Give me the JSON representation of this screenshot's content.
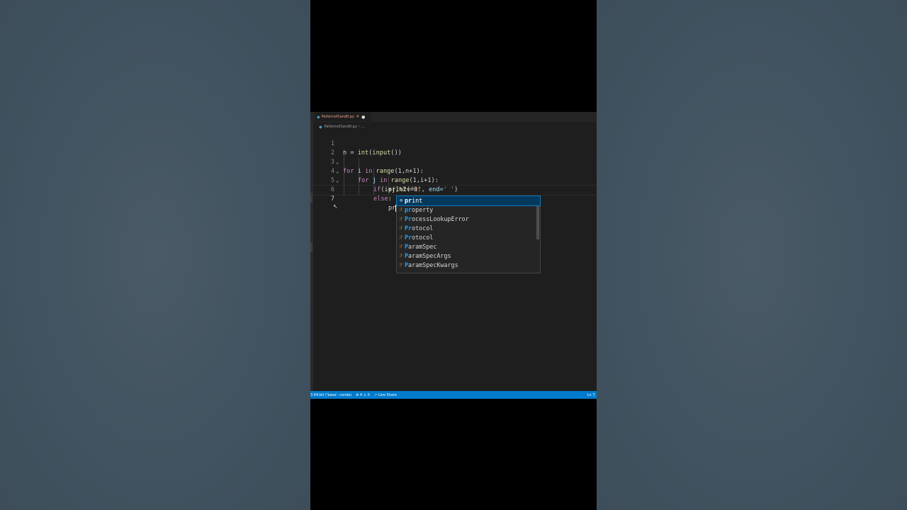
{
  "tab": {
    "filename": "Patternof1and0.py",
    "error_count": "4",
    "dirty_marker": "●",
    "file_icon": "python-icon"
  },
  "breadcrumb": {
    "file": "Patternof1and0.py",
    "more": "..."
  },
  "code_lines": [
    {
      "num": "1"
    },
    {
      "num": "2"
    },
    {
      "num": "3"
    },
    {
      "num": "4"
    },
    {
      "num": "5"
    },
    {
      "num": "6"
    },
    {
      "num": "7"
    }
  ],
  "code": {
    "l1": {
      "a": "n = ",
      "b": "int",
      "c": "(",
      "d": "input",
      "e": "())"
    },
    "l2": {
      "a": "for",
      "b": " i ",
      "c": "in",
      "d": " ",
      "e": "range",
      "f": "(1,n+1):"
    },
    "l3": {
      "a": "for",
      "b": " j ",
      "c": "in",
      "d": " ",
      "e": "range",
      "f": "(1,i+1):"
    },
    "l4": {
      "a": "if",
      "b": "(i+j)%2==0:"
    },
    "l5": {
      "a": "print",
      "b": "(",
      "c": "\"1\"",
      "d": ", end=",
      "e": "' '",
      "f": ")"
    },
    "l6": {
      "a": "else",
      "b": ":"
    },
    "l7": {
      "a": "pr"
    }
  },
  "suggestions": [
    {
      "icon": "⊕",
      "match": "pr",
      "rest": "int",
      "kind": "function"
    },
    {
      "icon": "ℱ",
      "match": "pr",
      "rest": "operty",
      "kind": "class"
    },
    {
      "icon": "ℱ",
      "match": "Pr",
      "rest": "ocessLookupError",
      "kind": "class"
    },
    {
      "icon": "ℱ",
      "match": "Pr",
      "rest": "otocol",
      "kind": "class"
    },
    {
      "icon": "ℱ",
      "match": "Pr",
      "rest": "otocol",
      "kind": "class"
    },
    {
      "icon": "ℱ",
      "match": "P",
      "rest": "aramSpec",
      "kind": "class"
    },
    {
      "icon": "ℱ",
      "match": "P",
      "rest": "aramSpecArgs",
      "kind": "class"
    },
    {
      "icon": "ℱ",
      "match": "P",
      "rest": "aramSpecKwargs",
      "kind": "class"
    }
  ],
  "statusbar": {
    "interpreter": "3 64-bit ('base': conda)",
    "problems": "⊗ 4 ⚠ 0",
    "liveshare": "Live Share",
    "position": "Ln 7,"
  },
  "colors": {
    "statusbar": "#007acc",
    "editor_bg": "#1e1e1e",
    "selected_suggestion": "#04395e"
  }
}
